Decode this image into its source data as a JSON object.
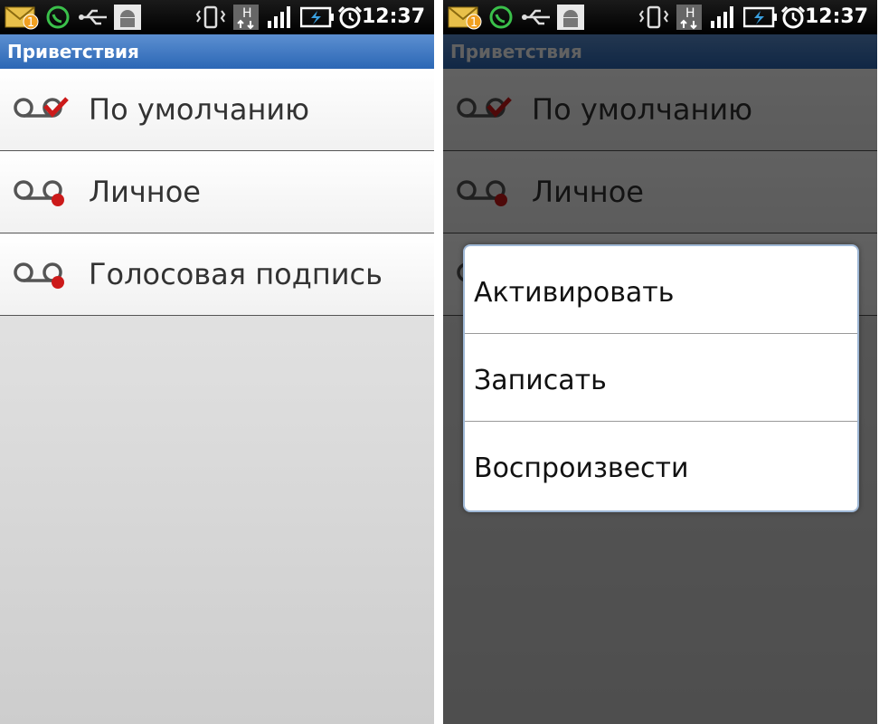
{
  "status_bar": {
    "time": "12:37",
    "notification_count": "1",
    "network_label": "H",
    "icons": [
      "mail-notification-icon",
      "whatsapp-icon",
      "usb-icon",
      "android-debug-icon",
      "vibrate-icon",
      "network-h-icon",
      "signal-icon",
      "battery-charging-icon",
      "alarm-icon"
    ]
  },
  "screen": {
    "title": "Приветствия",
    "greetings": [
      {
        "label": "По умолчанию",
        "icon": "voicemail-check-icon",
        "accent": "#cc1a1a"
      },
      {
        "label": "Личное",
        "icon": "voicemail-record-icon",
        "accent": "#cc1a1a"
      },
      {
        "label": "Голосовая подпись",
        "icon": "voicemail-record-icon",
        "accent": "#cc1a1a"
      }
    ]
  },
  "context_menu": {
    "items": [
      {
        "label": "Активировать"
      },
      {
        "label": "Записать"
      },
      {
        "label": "Воспроизвести"
      }
    ]
  },
  "colors": {
    "title_bar": "#2b67b5",
    "status_bar": "#000000",
    "dialog_border": "#9fb8d6"
  }
}
